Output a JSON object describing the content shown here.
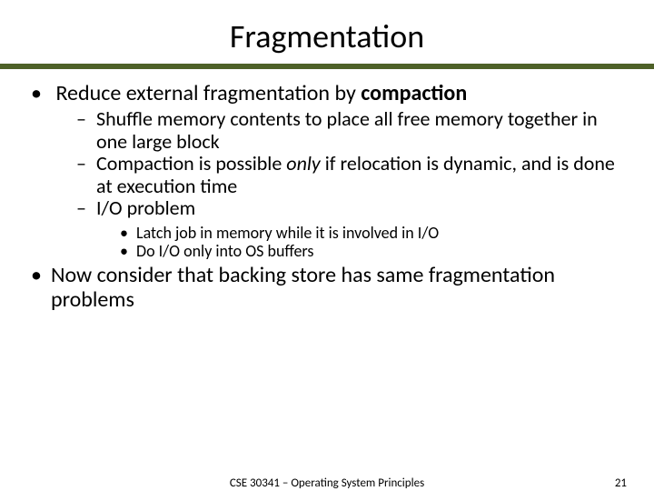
{
  "title": "Fragmentation",
  "bullets": {
    "b1_pre": "Reduce external fragmentation by ",
    "b1_bold": "compaction",
    "b1a": "Shuffle memory contents to place all free memory together in one large block",
    "b1b_pre": "Compaction is possible ",
    "b1b_italic": "only",
    "b1b_post": " if relocation is dynamic, and is done at execution time",
    "b1c": "I/O problem",
    "b1c_i": "Latch job in memory while it is involved in I/O",
    "b1c_ii": "Do I/O only into OS buffers",
    "b2": "Now consider that backing store has same fragmentation problems"
  },
  "footer": {
    "course": "CSE 30341 – Operating System Principles",
    "page": "21"
  }
}
